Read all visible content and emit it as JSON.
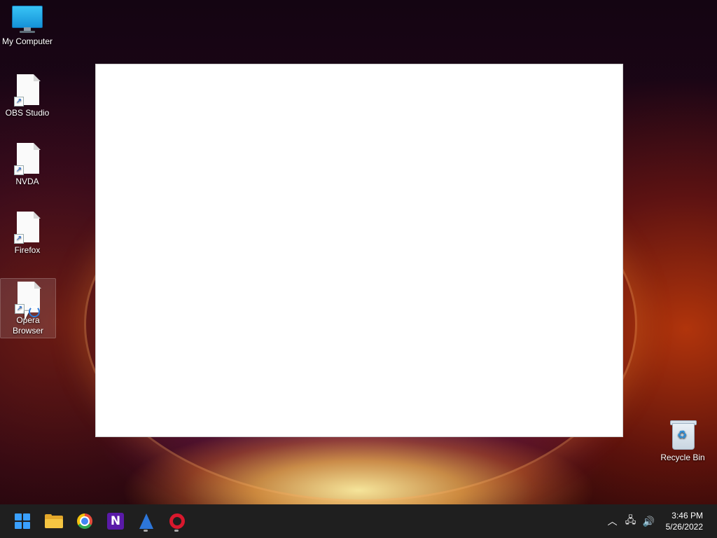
{
  "desktop": {
    "icons": [
      {
        "label": "My Computer"
      },
      {
        "label": "OBS Studio"
      },
      {
        "label": "NVDA"
      },
      {
        "label": "Firefox"
      },
      {
        "label": "Opera\nBrowser"
      },
      {
        "label": "Recycle Bin"
      }
    ]
  },
  "taskbar": {
    "apps": [
      "start-button",
      "file-explorer",
      "google-chrome",
      "nvda",
      "obs-studio",
      "opera"
    ],
    "clock": {
      "time": "3:46 PM",
      "date": "5/26/2022"
    }
  },
  "colors": {
    "taskbar": "#1f1f1f",
    "accent": "#3aa0ff"
  }
}
